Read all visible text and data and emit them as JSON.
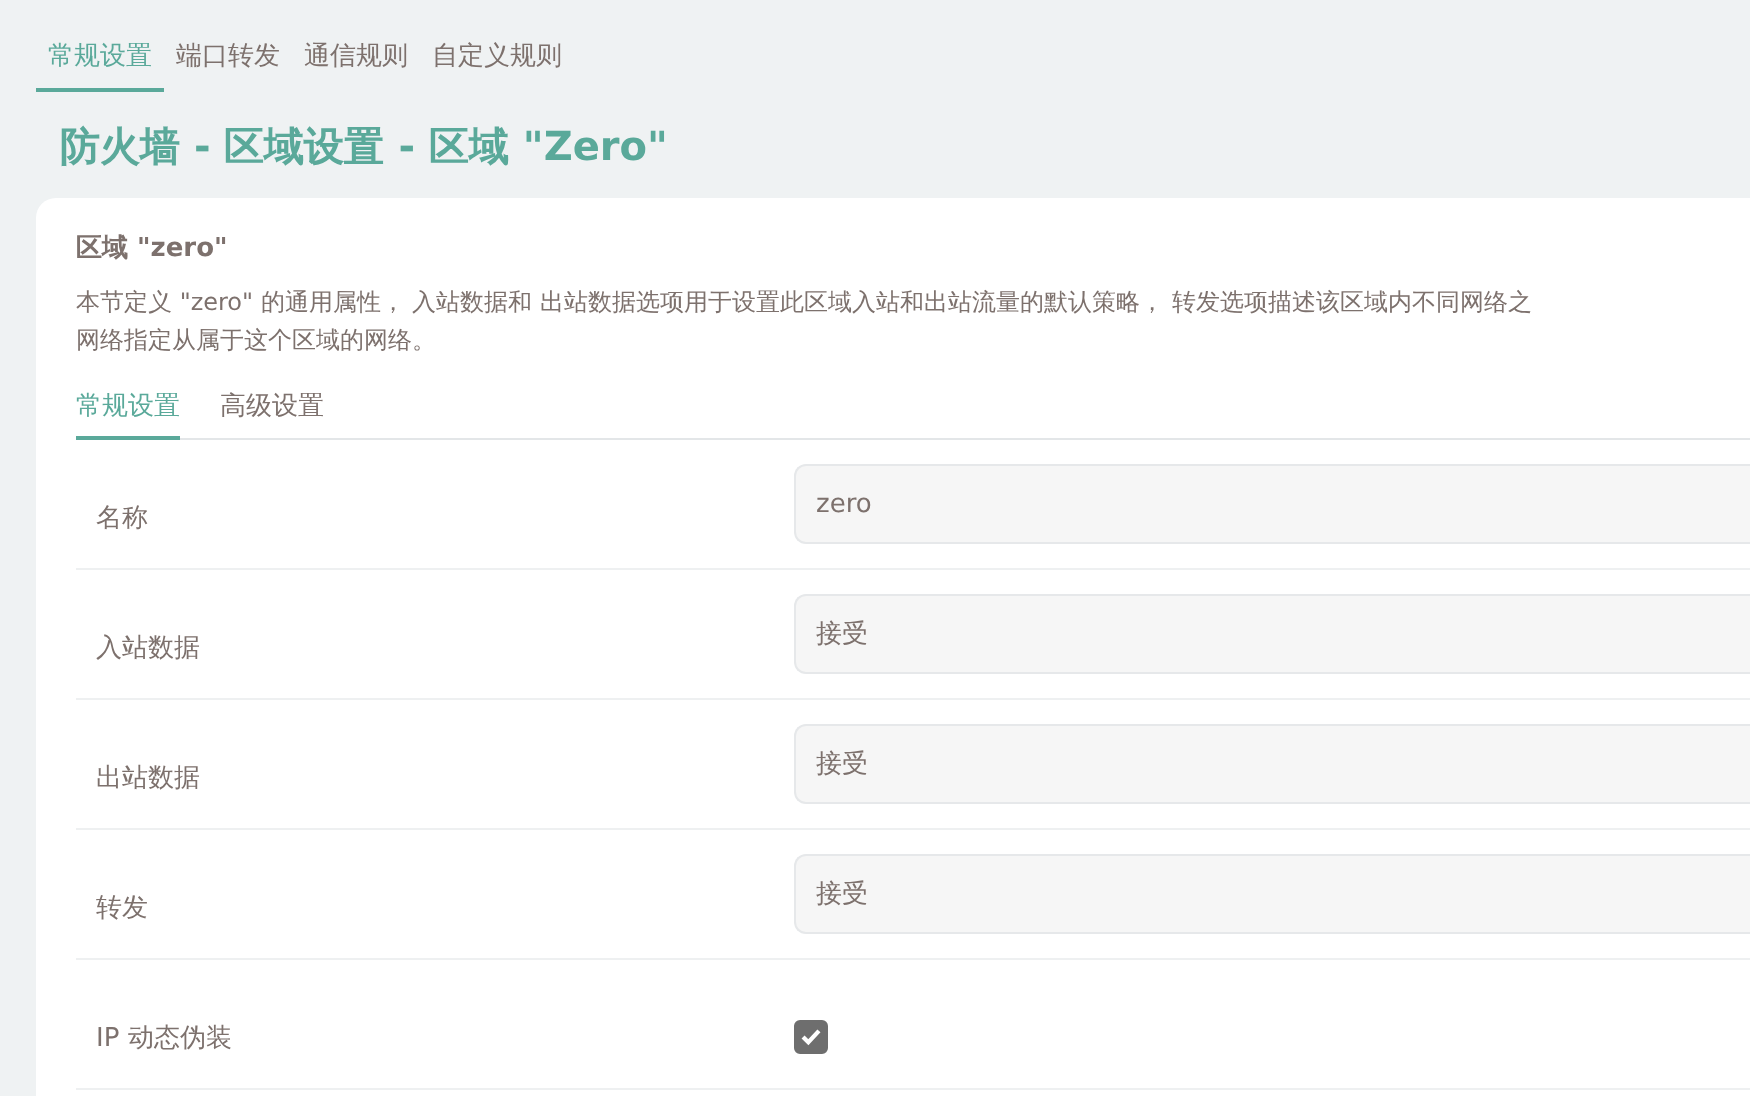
{
  "top_tabs": [
    {
      "label": "常规设置",
      "selected": true
    },
    {
      "label": "端口转发",
      "selected": false
    },
    {
      "label": "通信规则",
      "selected": false
    },
    {
      "label": "自定义规则",
      "selected": false
    }
  ],
  "page_title": "防火墙 - 区域设置 - 区域 \"Zero\"",
  "section": {
    "title": "区域 \"zero\"",
    "description_lines": [
      "本节定义 \"zero\" 的通用属性，  入站数据和  出站数据选项用于设置此区域入站和出站流量的默认策略，  转发选项描述该区域内不同网络之",
      "网络指定从属于这个区域的网络。"
    ],
    "tabs": [
      {
        "label": "常规设置",
        "selected": true
      },
      {
        "label": "高级设置",
        "selected": false
      }
    ],
    "fields": [
      {
        "kind": "input",
        "label": "名称",
        "value": "zero"
      },
      {
        "kind": "select",
        "label": "入站数据",
        "value": "接受"
      },
      {
        "kind": "select",
        "label": "出站数据",
        "value": "接受"
      },
      {
        "kind": "select",
        "label": "转发",
        "value": "接受"
      },
      {
        "kind": "checkbox",
        "label": "IP 动态伪装",
        "checked": true
      }
    ]
  }
}
